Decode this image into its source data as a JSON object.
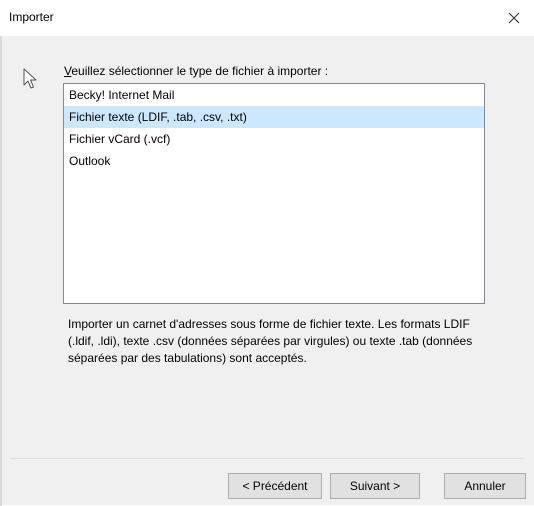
{
  "window": {
    "title": "Importer",
    "close_label": "Fermer"
  },
  "wizard": {
    "instruction_accelerator": "V",
    "instruction_rest": "euillez sélectionner le type de fichier à importer :",
    "items": [
      {
        "label": "Becky! Internet Mail",
        "selected": false
      },
      {
        "label": "Fichier texte (LDIF, .tab, .csv, .txt)",
        "selected": true
      },
      {
        "label": "Fichier vCard (.vcf)",
        "selected": false
      },
      {
        "label": "Outlook",
        "selected": false
      }
    ],
    "description": "Importer un carnet d'adresses sous forme de fichier texte. Les formats LDIF (.ldif, .ldi), texte .csv (données séparées par virgules) ou texte .tab (données séparées par des tabulations) sont acceptés."
  },
  "buttons": {
    "previous": "< Précédent",
    "next": "Suivant >",
    "cancel": "Annuler"
  },
  "colors": {
    "selected_row": "#cce8ff",
    "dialog_background": "#f0f0f0",
    "button_face": "#e1e1e1"
  },
  "icons": {
    "pointer": "pointer-icon",
    "close": "close-icon"
  }
}
